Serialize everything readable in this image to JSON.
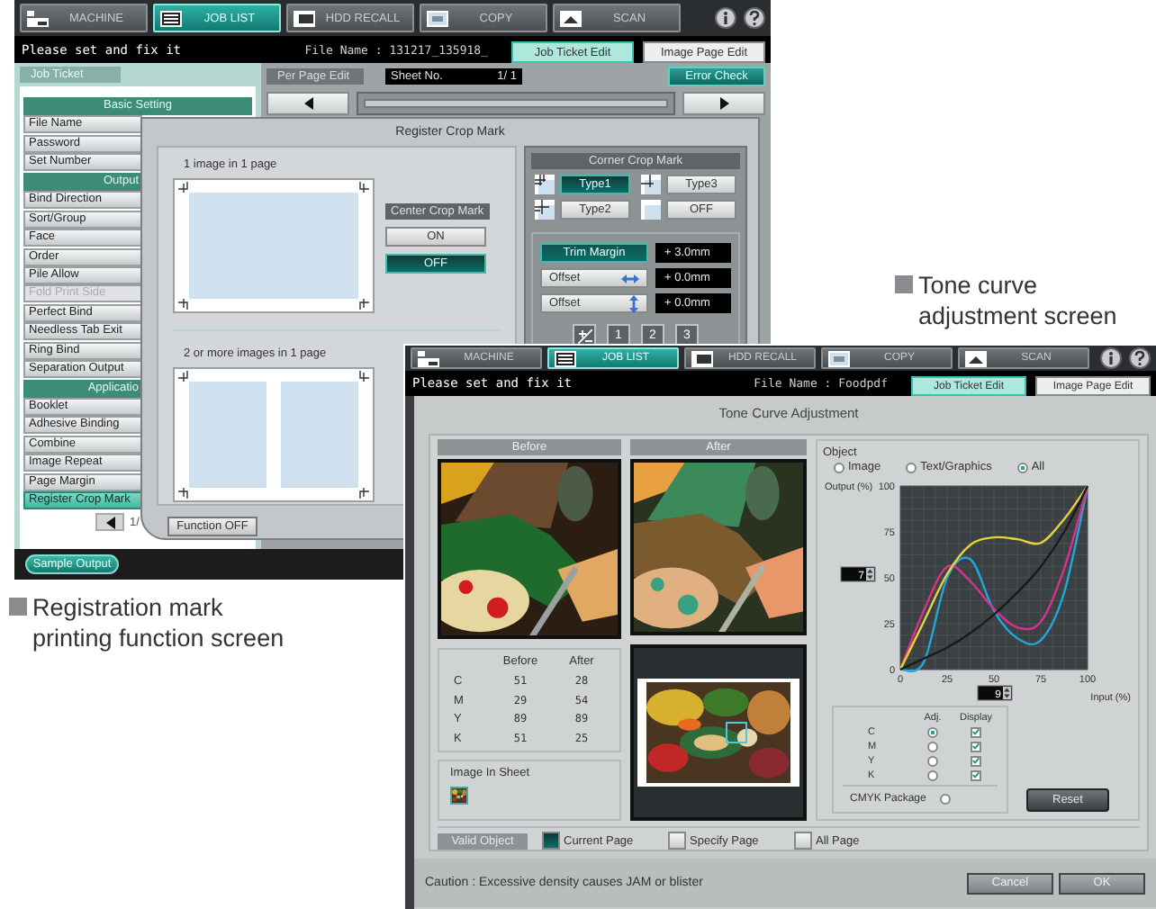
{
  "screen1": {
    "nav_tabs": [
      {
        "label": "MACHINE",
        "selected": false
      },
      {
        "label": "JOB LIST",
        "selected": true
      },
      {
        "label": "HDD RECALL",
        "selected": false
      },
      {
        "label": "COPY",
        "selected": false
      },
      {
        "label": "SCAN",
        "selected": false
      }
    ],
    "message": "Please set and fix it",
    "file_name": "File Name : 131217_135918_",
    "edit_tabs": [
      {
        "label": "Job Ticket Edit",
        "selected": true
      },
      {
        "label": "Image Page Edit",
        "selected": false
      }
    ],
    "panel_tab": "Job Ticket",
    "menu": [
      {
        "kind": "header",
        "label": "Basic Setting"
      },
      {
        "kind": "item",
        "label": "File Name",
        "selected": false,
        "disabled": false
      },
      {
        "kind": "item",
        "label": "Password",
        "selected": false,
        "disabled": false
      },
      {
        "kind": "item",
        "label": "Set Number",
        "selected": false,
        "disabled": false
      },
      {
        "kind": "header",
        "label": "Output"
      },
      {
        "kind": "item",
        "label": "Bind Direction",
        "selected": false,
        "disabled": false
      },
      {
        "kind": "item",
        "label": "Sort/Group",
        "selected": false,
        "disabled": false
      },
      {
        "kind": "item",
        "label": "Face",
        "selected": false,
        "disabled": false
      },
      {
        "kind": "item",
        "label": "Order",
        "selected": false,
        "disabled": false
      },
      {
        "kind": "item",
        "label": "Pile Allow",
        "selected": false,
        "disabled": false
      },
      {
        "kind": "item",
        "label": "Fold Print Side",
        "selected": false,
        "disabled": true
      },
      {
        "kind": "item",
        "label": "Perfect Bind",
        "selected": false,
        "disabled": false
      },
      {
        "kind": "item",
        "label": "Needless Tab Exit",
        "selected": false,
        "disabled": false
      },
      {
        "kind": "item",
        "label": "Ring Bind",
        "selected": false,
        "disabled": false
      },
      {
        "kind": "item",
        "label": "Separation Output",
        "selected": false,
        "disabled": false
      },
      {
        "kind": "header",
        "label": "Applicatio"
      },
      {
        "kind": "item",
        "label": "Booklet",
        "selected": false,
        "disabled": false
      },
      {
        "kind": "item",
        "label": "Adhesive Binding",
        "selected": false,
        "disabled": false
      },
      {
        "kind": "item",
        "label": "Combine",
        "selected": false,
        "disabled": false
      },
      {
        "kind": "item",
        "label": "Image Repeat",
        "selected": false,
        "disabled": false
      },
      {
        "kind": "item",
        "label": "Page Margin",
        "selected": false,
        "disabled": false
      },
      {
        "kind": "item",
        "label": "Register Crop Mark",
        "selected": true,
        "disabled": false
      }
    ],
    "page_indicator": "1/",
    "sample_output": "Sample Output",
    "per_page_edit": "Per Page Edit",
    "sheet": {
      "label": "Sheet No.",
      "value": "1/ 1"
    },
    "error_check": "Error Check",
    "dialog": {
      "title": "Register Crop Mark",
      "single_label": "1 image in 1 page",
      "multi_label": "2 or more images in 1 page",
      "center_crop_mark": {
        "label": "Center Crop Mark",
        "options": [
          {
            "label": "ON",
            "selected": false
          },
          {
            "label": "OFF",
            "selected": true
          }
        ]
      },
      "corner_crop_mark": {
        "label": "Corner Crop Mark",
        "options": [
          {
            "label": "Type1",
            "selected": true
          },
          {
            "label": "Type3",
            "selected": false
          },
          {
            "label": "Type2",
            "selected": false
          },
          {
            "label": "OFF",
            "selected": false
          }
        ]
      },
      "adjustments": [
        {
          "kind": "trim",
          "label": "Trim Margin",
          "selected": true,
          "value": "+ 3.0mm"
        },
        {
          "kind": "horizontal",
          "label": "Offset",
          "selected": false,
          "value": "+ 0.0mm"
        },
        {
          "kind": "vertical",
          "label": "Offset",
          "selected": false,
          "value": "+ 0.0mm"
        }
      ],
      "keypad": [
        "1",
        "2",
        "3"
      ],
      "function_off": "Function OFF"
    }
  },
  "screen2": {
    "nav_tabs": [
      {
        "label": "MACHINE",
        "selected": false
      },
      {
        "label": "JOB LIST",
        "selected": true
      },
      {
        "label": "HDD RECALL",
        "selected": false
      },
      {
        "label": "COPY",
        "selected": false
      },
      {
        "label": "SCAN",
        "selected": false
      }
    ],
    "message": "Please set and fix it",
    "file_name": "File Name : Foodpdf",
    "edit_tabs": [
      {
        "label": "Job Ticket Edit",
        "selected": true
      },
      {
        "label": "Image Page Edit",
        "selected": false
      }
    ],
    "dialog": {
      "title": "Tone Curve Adjustment",
      "before_label": "Before",
      "after_label": "After",
      "density": {
        "columns": [
          "Before",
          "After"
        ],
        "rows": [
          {
            "channel": "C",
            "before": "51",
            "after": "28"
          },
          {
            "channel": "M",
            "before": "29",
            "after": "54"
          },
          {
            "channel": "Y",
            "before": "89",
            "after": "89"
          },
          {
            "channel": "K",
            "before": "51",
            "after": "25"
          }
        ]
      },
      "image_in_sheet": "Image In Sheet",
      "object": {
        "label": "Object",
        "options": [
          {
            "label": "Image",
            "selected": false
          },
          {
            "label": "Text/Graphics",
            "selected": false
          },
          {
            "label": "All",
            "selected": true
          }
        ]
      },
      "output_value": "7",
      "input_value": "9",
      "chart_data": {
        "type": "line",
        "xlabel": "Input (%)",
        "ylabel": "Output (%)",
        "x": [
          0,
          12.5,
          25,
          37.5,
          50,
          62.5,
          75,
          87.5,
          100
        ],
        "xlim": [
          0,
          100
        ],
        "ylim": [
          0,
          100
        ],
        "xticks": [
          0,
          25,
          50,
          75,
          100
        ],
        "yticks": [
          0,
          25,
          50,
          75,
          100
        ],
        "grid": true,
        "series": [
          {
            "color": "#1ea8dc",
            "values": [
              0,
              4,
              50,
              60,
              32,
              17,
              16,
              42,
              100
            ]
          },
          {
            "color": "#d8328c",
            "values": [
              0,
              32,
              56,
              48,
              33,
              23,
              26,
              55,
              100
            ]
          },
          {
            "color": "#e6d23c",
            "values": [
              0,
              26,
              52,
              68,
              72,
              71,
              69,
              82,
              100
            ]
          },
          {
            "color": "#1a1a1a",
            "values": [
              0,
              6,
              12,
              20,
              30,
              42,
              56,
              75,
              100
            ]
          }
        ]
      },
      "channel_columns": [
        "Adj.",
        "Display"
      ],
      "channels": [
        {
          "label": "C",
          "adjust": true,
          "display": true
        },
        {
          "label": "M",
          "adjust": false,
          "display": true
        },
        {
          "label": "Y",
          "adjust": false,
          "display": true
        },
        {
          "label": "K",
          "adjust": false,
          "display": true
        }
      ],
      "cmyk_package": {
        "label": "CMYK Package",
        "selected": false
      },
      "reset": "Reset",
      "valid_object": {
        "label": "Valid Object",
        "options": [
          {
            "label": "Current Page",
            "selected": true
          },
          {
            "label": "Specify Page",
            "selected": false
          },
          {
            "label": "All Page",
            "selected": false
          }
        ]
      },
      "caution": "Caution : Excessive density causes JAM or blister",
      "buttons": [
        "Cancel",
        "OK"
      ]
    }
  },
  "captions": [
    {
      "text": "Registration mark\nprinting function screen"
    },
    {
      "text": "Tone curve\nadjustment screen"
    }
  ]
}
